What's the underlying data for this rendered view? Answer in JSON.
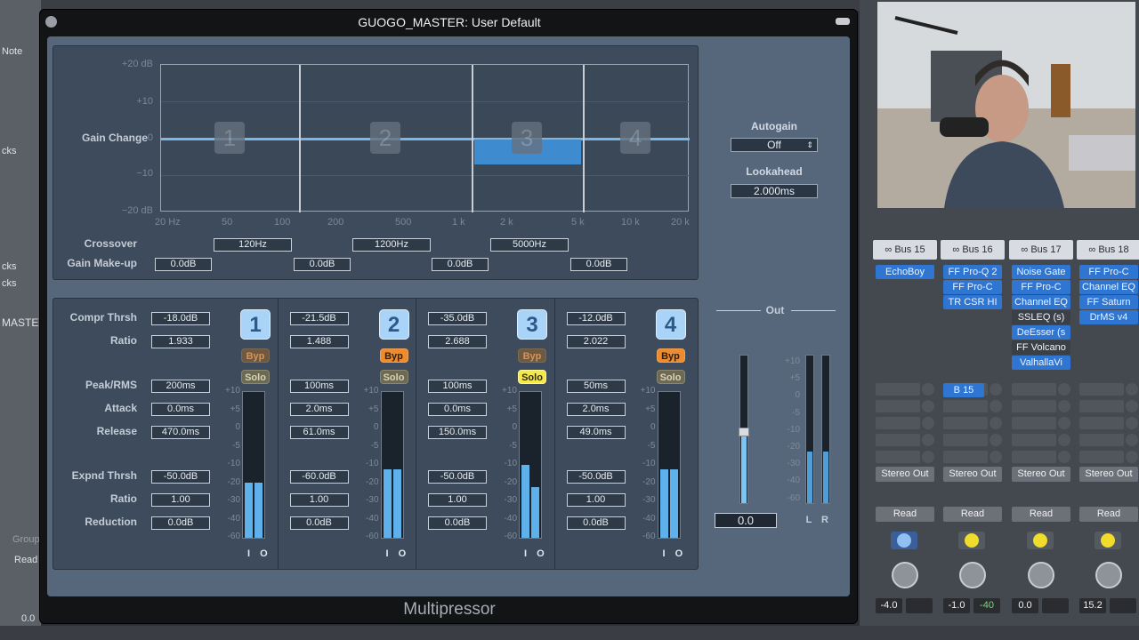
{
  "window": {
    "title": "GUOGO_MASTER: User Default",
    "plugin_name": "Multipressor"
  },
  "graph": {
    "y_labels": [
      "+20 dB",
      "+10",
      "Gain Change",
      "0",
      "−10",
      "−20 dB"
    ],
    "x_labels": [
      "20 Hz",
      "50",
      "100",
      "200",
      "500",
      "1 k",
      "2 k",
      "5 k",
      "10 k",
      "20 k"
    ],
    "band_labels": [
      "1",
      "2",
      "3",
      "4"
    ]
  },
  "crossover": {
    "label": "Crossover",
    "values": [
      "120Hz",
      "1200Hz",
      "5000Hz"
    ]
  },
  "makeup": {
    "label": "Gain Make-up",
    "values": [
      "0.0dB",
      "0.0dB",
      "0.0dB",
      "0.0dB"
    ]
  },
  "autogain": {
    "label": "Autogain",
    "value": "Off"
  },
  "lookahead": {
    "label": "Lookahead",
    "value": "2.000ms"
  },
  "param_labels": {
    "compr_thrsh": "Compr Thrsh",
    "ratio": "Ratio",
    "peak_rms": "Peak/RMS",
    "attack": "Attack",
    "release": "Release",
    "expnd_thrsh": "Expnd Thrsh",
    "ratio2": "Ratio",
    "reduction": "Reduction"
  },
  "bands": [
    {
      "num": "1",
      "compr_thrsh": "-18.0dB",
      "ratio": "1.933",
      "peak_rms": "200ms",
      "attack": "0.0ms",
      "release": "470.0ms",
      "expnd_thrsh": "-50.0dB",
      "exp_ratio": "1.00",
      "reduction": "0.0dB",
      "byp": "Byp",
      "solo": "Solo",
      "byp_on": false,
      "solo_on": false,
      "level_l": 0.38,
      "level_r": 0.38,
      "io": "I O"
    },
    {
      "num": "2",
      "compr_thrsh": "-21.5dB",
      "ratio": "1.488",
      "peak_rms": "100ms",
      "attack": "2.0ms",
      "release": "61.0ms",
      "expnd_thrsh": "-60.0dB",
      "exp_ratio": "1.00",
      "reduction": "0.0dB",
      "byp": "Byp",
      "solo": "Solo",
      "byp_on": true,
      "solo_on": false,
      "level_l": 0.47,
      "level_r": 0.47,
      "io": "I O"
    },
    {
      "num": "3",
      "compr_thrsh": "-35.0dB",
      "ratio": "2.688",
      "peak_rms": "100ms",
      "attack": "0.0ms",
      "release": "150.0ms",
      "expnd_thrsh": "-50.0dB",
      "exp_ratio": "1.00",
      "reduction": "0.0dB",
      "byp": "Byp",
      "solo": "Solo",
      "byp_on": false,
      "solo_on": true,
      "level_l": 0.5,
      "level_r": 0.35,
      "io": "I O"
    },
    {
      "num": "4",
      "compr_thrsh": "-12.0dB",
      "ratio": "2.022",
      "peak_rms": "50ms",
      "attack": "2.0ms",
      "release": "49.0ms",
      "expnd_thrsh": "-50.0dB",
      "exp_ratio": "1.00",
      "reduction": "0.0dB",
      "byp": "Byp",
      "solo": "Solo",
      "byp_on": true,
      "solo_on": false,
      "level_l": 0.47,
      "level_r": 0.47,
      "io": "I O"
    }
  ],
  "meter_scale": [
    "+10",
    "+5",
    "0",
    "-5",
    "-10",
    "-20",
    "-30",
    "-40",
    "-60"
  ],
  "output": {
    "label": "Out",
    "value": "0.0",
    "lr": [
      "L",
      "R"
    ],
    "fader_level": 0.48,
    "meter_l": 0.35,
    "meter_r": 0.35
  },
  "mixer": {
    "strips": [
      {
        "bus": "Bus 15",
        "plugins": [
          "EchoBoy"
        ],
        "send": "",
        "output": "Stereo Out",
        "auto": "Read",
        "vol": "-4.0",
        "pan": ""
      },
      {
        "bus": "Bus 16",
        "plugins": [
          "FF Pro-Q 2",
          "FF Pro-C",
          "TR CSR HI"
        ],
        "send": "B 15",
        "output": "Stereo Out",
        "auto": "Read",
        "vol": "-1.0",
        "pan": "-40"
      },
      {
        "bus": "Bus 17",
        "plugins": [
          "Noise Gate",
          "FF Pro-C",
          "Channel EQ",
          "SSLEQ (s)",
          "DeEsser (s",
          "FF Volcano",
          "ValhallaVi"
        ],
        "send": "",
        "output": "Stereo Out",
        "auto": "Read",
        "vol": "0.0",
        "pan": ""
      },
      {
        "bus": "Bus 18",
        "plugins": [
          "FF Pro-C",
          "Channel EQ",
          "FF Saturn",
          "DrMS v4"
        ],
        "send": "",
        "output": "Stereo Out",
        "auto": "Read",
        "vol": "15.2",
        "pan": ""
      }
    ]
  },
  "left_edge": {
    "items": [
      "Note",
      "cks",
      "cks",
      "cks",
      "MASTE",
      "Group",
      "Read",
      "0.0"
    ]
  },
  "colors": {
    "accent": "#5fb1ec",
    "bypass_on": "#ee8b2c",
    "solo_on": "#f5e84a",
    "plugin_slot": "#2f75d2"
  }
}
